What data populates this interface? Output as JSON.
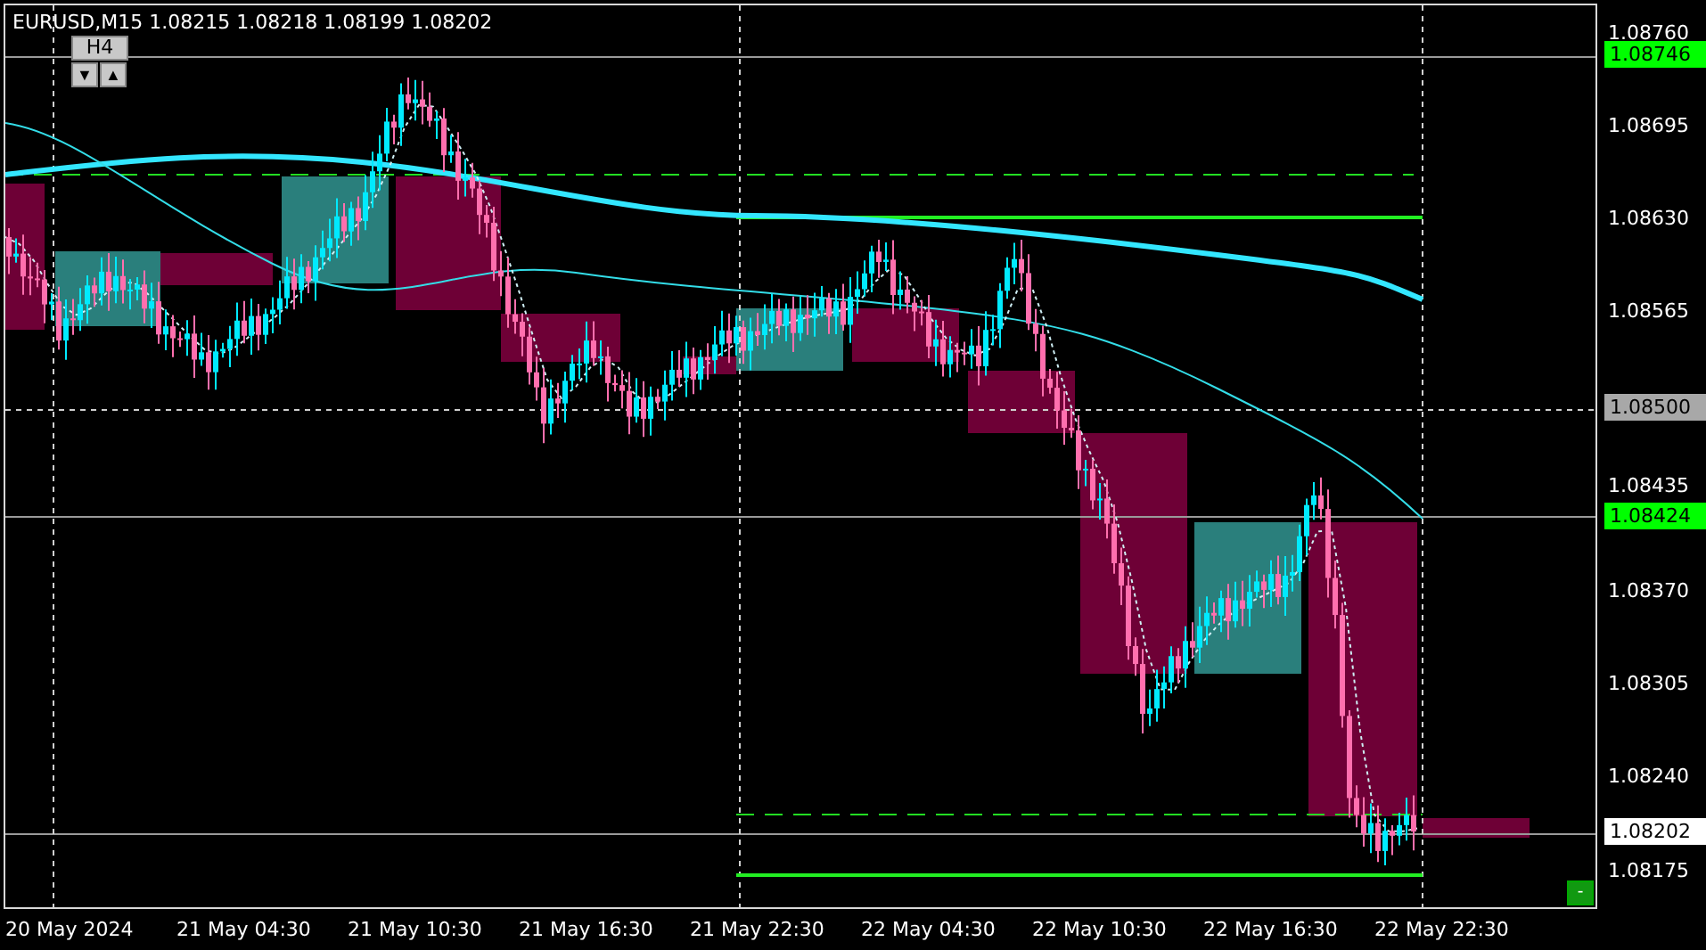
{
  "chart": {
    "title": "EURUSD,M15  1.08215 1.08218 1.08199 1.08202",
    "timeframe_button": "H4",
    "scroll_buttons": [
      "▼",
      "▲"
    ],
    "corner_button": "-",
    "price_axis": [
      {
        "label": "1.08760",
        "kind": "tick"
      },
      {
        "label": "1.08746",
        "kind": "line-tag"
      },
      {
        "label": "1.08695",
        "kind": "tick"
      },
      {
        "label": "1.08630",
        "kind": "tick"
      },
      {
        "label": "1.08565",
        "kind": "tick"
      },
      {
        "label": "1.08500",
        "kind": "grid-tag"
      },
      {
        "label": "1.08435",
        "kind": "tick"
      },
      {
        "label": "1.08424",
        "kind": "line-tag"
      },
      {
        "label": "1.08370",
        "kind": "tick"
      },
      {
        "label": "1.08305",
        "kind": "tick"
      },
      {
        "label": "1.08240",
        "kind": "tick"
      },
      {
        "label": "1.08202",
        "kind": "price-tag"
      },
      {
        "label": "1.08175",
        "kind": "tick"
      }
    ],
    "time_axis": [
      "20 May 2024",
      "21 May 04:30",
      "21 May 10:30",
      "21 May 16:30",
      "21 May 22:30",
      "22 May 04:30",
      "22 May 10:30",
      "22 May 16:30",
      "22 May 22:30"
    ]
  }
}
